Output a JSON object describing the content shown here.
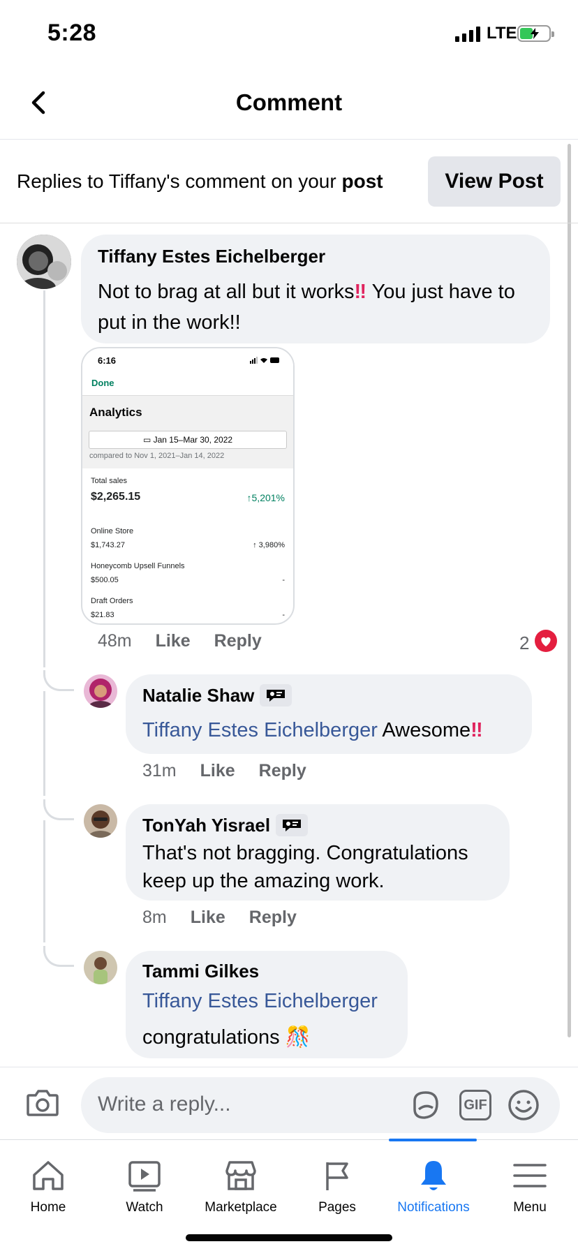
{
  "status_bar": {
    "time": "5:28",
    "network": "LTE"
  },
  "header": {
    "title": "Comment"
  },
  "banner": {
    "text_prefix": "Replies to Tiffany's comment on your ",
    "text_bold": "post",
    "button_label": "View Post"
  },
  "main_comment": {
    "author": "Tiffany Estes Eichelberger",
    "text_part1": "Not to brag at all but it works",
    "emphasis": "‼",
    "text_part2": " You just have to put in the work!!",
    "time": "48m",
    "like_label": "Like",
    "reply_label": "Reply",
    "reaction_count": "2",
    "attachment": {
      "time": "6:16",
      "done": "Done",
      "title": "Analytics",
      "date_range": "Jan 15–Mar 30, 2022",
      "compared": "compared to Nov 1, 2021–Jan 14, 2022",
      "total_label": "Total sales",
      "total_value": "$2,265.15",
      "total_change": "↑5,201%",
      "rows": [
        {
          "label": "Online Store",
          "value": "$1,743.27",
          "change": "↑ 3,980%"
        },
        {
          "label": "Honeycomb Upsell Funnels",
          "value": "$500.05",
          "change": "-"
        },
        {
          "label": "Draft Orders",
          "value": "$21.83",
          "change": "-"
        }
      ]
    }
  },
  "replies": [
    {
      "author": "Natalie Shaw",
      "mention": "Tiffany Estes Eichelberger",
      "text": " Awesome",
      "emphasis": "‼",
      "time": "31m",
      "like_label": "Like",
      "reply_label": "Reply"
    },
    {
      "author": "TonYah Yisrael",
      "text": "That's not bragging. Congratulations keep up the amazing work.",
      "time": "8m",
      "like_label": "Like",
      "reply_label": "Reply"
    },
    {
      "author": "Tammi Gilkes",
      "mention": "Tiffany Estes Eichelberger",
      "text": "congratulations",
      "emoji": "🎊"
    }
  ],
  "reply_bar": {
    "placeholder": "Write a reply...",
    "gif_label": "GIF"
  },
  "tabs": [
    {
      "label": "Home",
      "icon": "home-icon"
    },
    {
      "label": "Watch",
      "icon": "watch-icon"
    },
    {
      "label": "Marketplace",
      "icon": "marketplace-icon"
    },
    {
      "label": "Pages",
      "icon": "flag-icon"
    },
    {
      "label": "Notifications",
      "icon": "bell-icon",
      "active": true
    },
    {
      "label": "Menu",
      "icon": "menu-icon"
    }
  ],
  "colors": {
    "link": "#385898",
    "active_tab": "#1877f2",
    "bubble": "#f0f2f5",
    "heart": "#e41e3f"
  }
}
